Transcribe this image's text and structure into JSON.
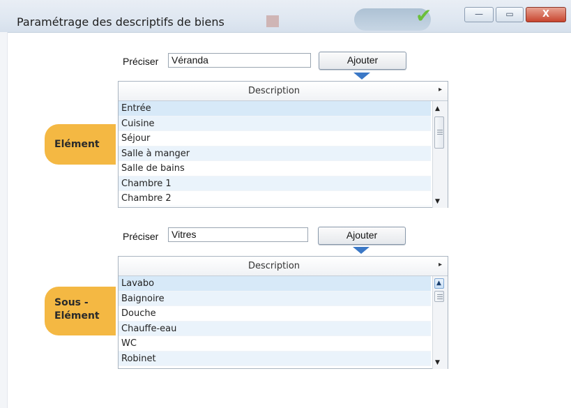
{
  "window": {
    "title": "Paramétrage des descriptifs de biens",
    "controls": {
      "minimize": "—",
      "maximize": "▭",
      "close": "X"
    }
  },
  "section_element": {
    "tag": "Elément",
    "field_label": "Préciser",
    "field_value": "Véranda",
    "button_label": "Ajouter",
    "grid": {
      "header": "Description",
      "rows": [
        "Entrée",
        "Cuisine",
        "Séjour",
        "Salle à manger",
        "Salle de bains",
        "Chambre 1",
        "Chambre 2"
      ]
    }
  },
  "section_sous_element": {
    "tag_line1": "Sous -",
    "tag_line2": "Elément",
    "field_label": "Préciser",
    "field_value": "Vitres",
    "button_label": "Ajouter",
    "grid": {
      "header": "Description",
      "rows": [
        "Lavabo",
        "Baignoire",
        "Douche",
        "Chauffe-eau",
        "WC",
        "Robinet"
      ]
    }
  },
  "icons": {
    "checkmark": "checkmark-icon",
    "header_menu": "triangle-right-icon",
    "scroll_up": "arrow-up-icon",
    "scroll_down": "arrow-down-icon"
  },
  "colors": {
    "tag": "#f4b843",
    "selection": "#d7e9f8",
    "alt_row": "#eaf3fb",
    "button_arrow": "#3b78c6"
  }
}
